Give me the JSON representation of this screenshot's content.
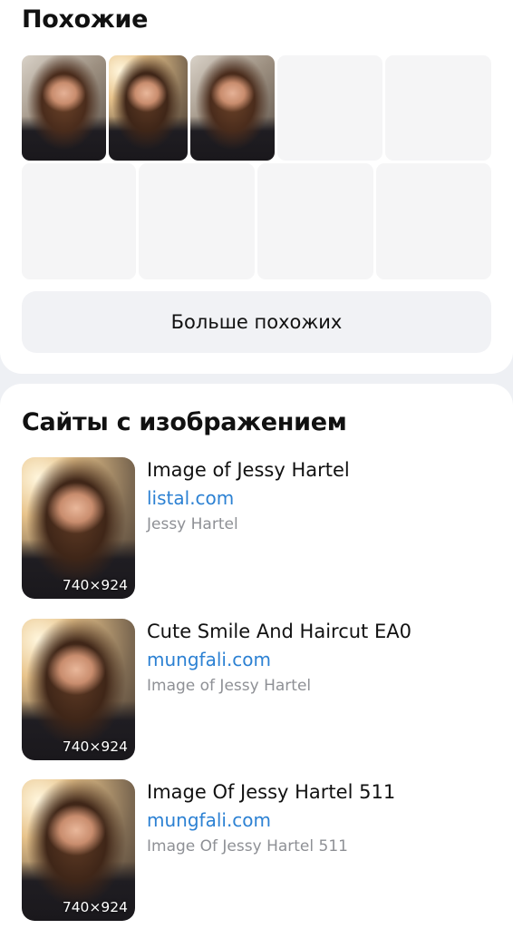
{
  "similar": {
    "title": "Похожие",
    "more_label": "Больше похожих"
  },
  "sites": {
    "title": "Сайты с изображением",
    "items": [
      {
        "title": "Image of Jessy Hartel",
        "domain": "listal.com",
        "description": "Jessy Hartel",
        "resolution": "740×924"
      },
      {
        "title": "Cute Smile And Haircut EA0",
        "domain": "mungfali.com",
        "description": "Image of Jessy Hartel",
        "resolution": "740×924"
      },
      {
        "title": "Image Of Jessy Hartel 511",
        "domain": "mungfali.com",
        "description": "Image Of Jessy Hartel 511",
        "resolution": "740×924"
      }
    ]
  }
}
